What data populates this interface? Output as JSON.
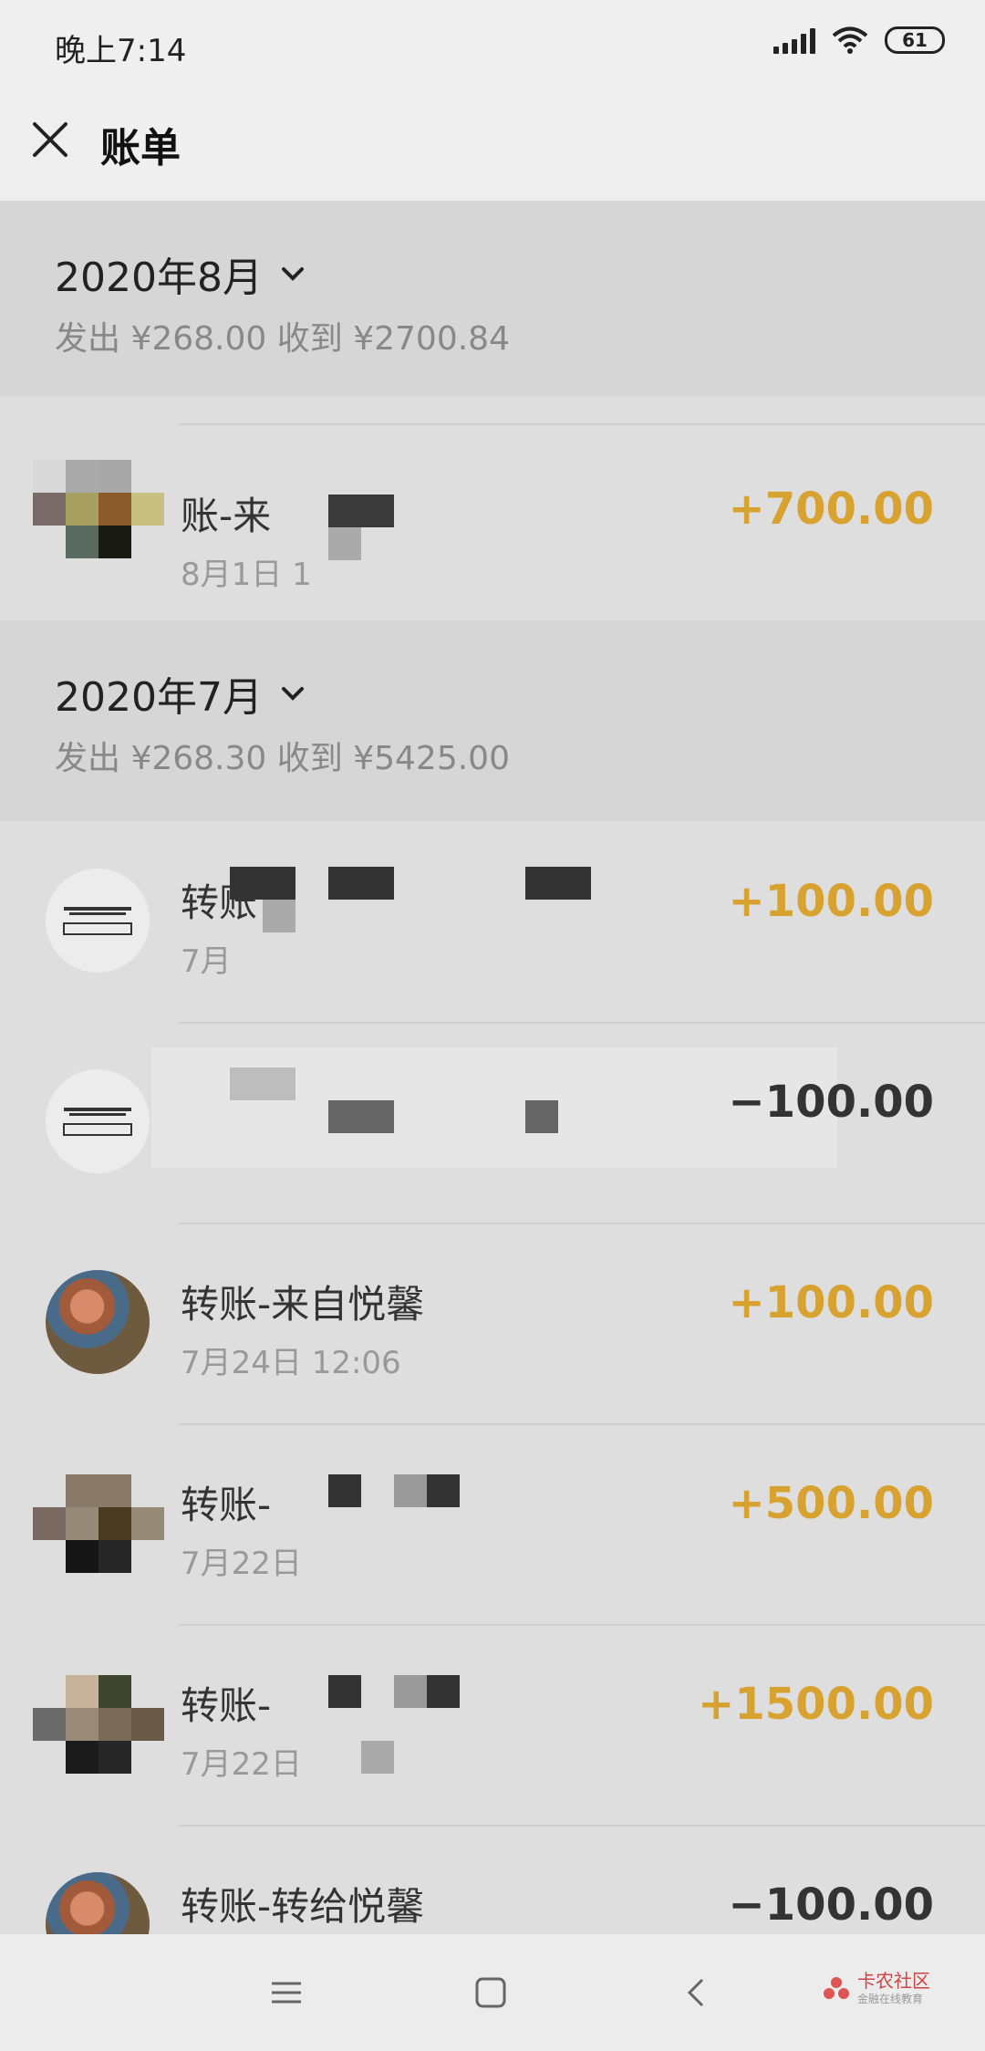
{
  "status": {
    "time": "晚上7:14",
    "battery": "61"
  },
  "header": {
    "title": "账单"
  },
  "months": [
    {
      "label": "2020年8月",
      "summary": "发出 ¥268.00 收到 ¥2700.84"
    },
    {
      "label": "2020年7月",
      "summary": "发出 ¥268.30 收到 ¥5425.00"
    }
  ],
  "transactions": [
    {
      "name": "账-来",
      "time": "8月1日 1",
      "amount": "+700.00",
      "direction": "in",
      "avatar": "pixelated"
    },
    {
      "name": "转账",
      "time": "7月",
      "amount": "+100.00",
      "direction": "in",
      "avatar": "logo"
    },
    {
      "name": "",
      "time": "",
      "amount": "−100.00",
      "direction": "out",
      "avatar": "logo"
    },
    {
      "name": "转账-来自悦馨",
      "time": "7月24日 12:06",
      "amount": "+100.00",
      "direction": "in",
      "avatar": "photo"
    },
    {
      "name": "转账-",
      "time": "7月22日",
      "amount": "+500.00",
      "direction": "in",
      "avatar": "pixelated"
    },
    {
      "name": "转账-",
      "time": "7月22日",
      "amount": "+1500.00",
      "direction": "in",
      "avatar": "pixelated"
    },
    {
      "name": "转账-转给悦馨",
      "time": "",
      "amount": "−100.00",
      "direction": "out",
      "avatar": "photo"
    }
  ],
  "colors": {
    "income": "#d8a230",
    "expense": "#333333",
    "header_bg": "#d6d6d6"
  },
  "icons": {
    "close": "close-icon",
    "chevron": "chevron-down-icon",
    "menu": "menu-icon",
    "home": "home-icon",
    "back": "back-icon"
  },
  "watermark": {
    "brand": "卡农社区",
    "tagline": "金融在线教育"
  }
}
